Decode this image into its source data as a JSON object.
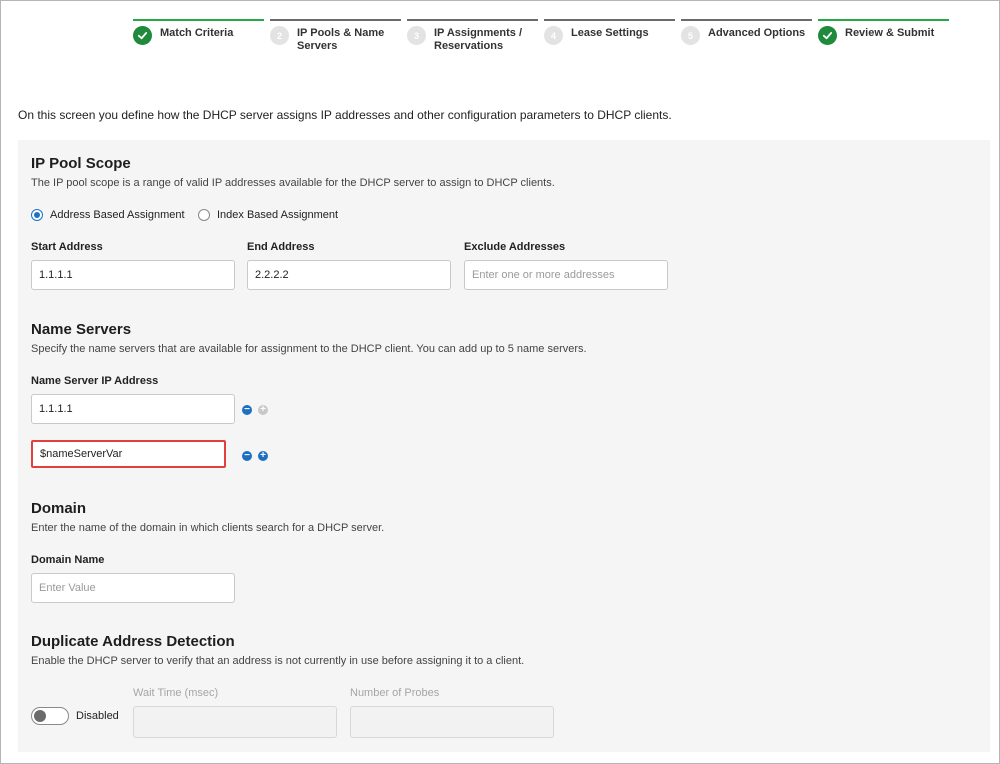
{
  "wizard": {
    "steps": [
      {
        "number": "",
        "label": "Match Criteria",
        "status": "done"
      },
      {
        "number": "2",
        "label": "IP Pools & Name Servers",
        "status": "pending"
      },
      {
        "number": "3",
        "label": "IP Assignments / Reservations",
        "status": "pending"
      },
      {
        "number": "4",
        "label": "Lease Settings",
        "status": "pending"
      },
      {
        "number": "5",
        "label": "Advanced Options",
        "status": "pending"
      },
      {
        "number": "",
        "label": "Review & Submit",
        "status": "done"
      }
    ]
  },
  "intro": "On this screen you define how the DHCP server assigns IP addresses and other configuration parameters to DHCP clients.",
  "ip_pool": {
    "title": "IP Pool Scope",
    "description": "The IP pool scope is a range of valid IP addresses available for the DHCP server to assign to DHCP clients.",
    "assignment_options": [
      "Address Based Assignment",
      "Index Based Assignment"
    ],
    "selected_option": "Address Based Assignment",
    "start_label": "Start Address",
    "start_value": "1.1.1.1",
    "end_label": "End Address",
    "end_value": "2.2.2.2",
    "exclude_label": "Exclude Addresses",
    "exclude_placeholder": "Enter one or more addresses"
  },
  "name_servers": {
    "title": "Name Servers",
    "description": "Specify the name servers that are available for assignment to the DHCP client. You can add up to 5 name servers.",
    "field_label": "Name Server IP Address",
    "entries": [
      "1.1.1.1",
      "$nameServerVar"
    ],
    "remove_symbol": "−",
    "add_symbol": "+"
  },
  "domain": {
    "title": "Domain",
    "description": "Enter the name of the domain in which clients search for a DHCP server.",
    "field_label": "Domain Name",
    "placeholder": "Enter Value"
  },
  "duplicate_detection": {
    "title": "Duplicate Address Detection",
    "description": "Enable the DHCP server to verify that an address is not currently in use before assigning it to a client.",
    "toggle_label": "Disabled",
    "wait_time_label": "Wait Time (msec)",
    "probes_label": "Number of Probes"
  },
  "colors": {
    "accent": "#1a73c8",
    "done_green": "#1f8a3c",
    "highlight_red": "#e0413a"
  }
}
